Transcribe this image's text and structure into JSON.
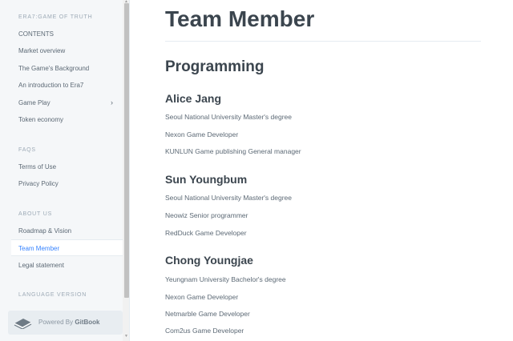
{
  "sidebar": {
    "sections": [
      {
        "title": "ERA7:GAME OF TRUTH",
        "items": [
          {
            "label": "CONTENTS"
          },
          {
            "label": "Market overview"
          },
          {
            "label": "The Game's Background"
          },
          {
            "label": "An introduction to Era7"
          },
          {
            "label": "Game Play",
            "chevron": "›"
          },
          {
            "label": "Token economy"
          }
        ]
      },
      {
        "title": "FAQS",
        "items": [
          {
            "label": "Terms of Use"
          },
          {
            "label": "Privacy Policy"
          }
        ]
      },
      {
        "title": "ABOUT US",
        "items": [
          {
            "label": "Roadmap & Vision"
          },
          {
            "label": "Team Member",
            "active": true
          },
          {
            "label": "Legal statement"
          }
        ]
      },
      {
        "title": "LANGUAGE VERSION",
        "items": []
      }
    ],
    "footer": {
      "prefix": "Powered By",
      "brand": "GitBook",
      "icon": "gitbook-icon"
    },
    "active_color": "#3884ff"
  },
  "main": {
    "title": "Team Member",
    "section": "Programming",
    "members": [
      {
        "name": "Alice Jang",
        "lines": [
          "Seoul National University Master's degree",
          "Nexon Game Developer",
          "KUNLUN Game publishing General manager"
        ]
      },
      {
        "name": "Sun Youngbum",
        "lines": [
          "Seoul National University Master's degree",
          "Neowiz Senior programmer",
          "RedDuck Game Developer"
        ]
      },
      {
        "name": "Chong Youngjae",
        "lines": [
          "Yeungnam University Bachelor's degree",
          "Nexon Game Developer",
          "Netmarble Game Developer",
          "Com2us Game Developer"
        ]
      }
    ]
  }
}
